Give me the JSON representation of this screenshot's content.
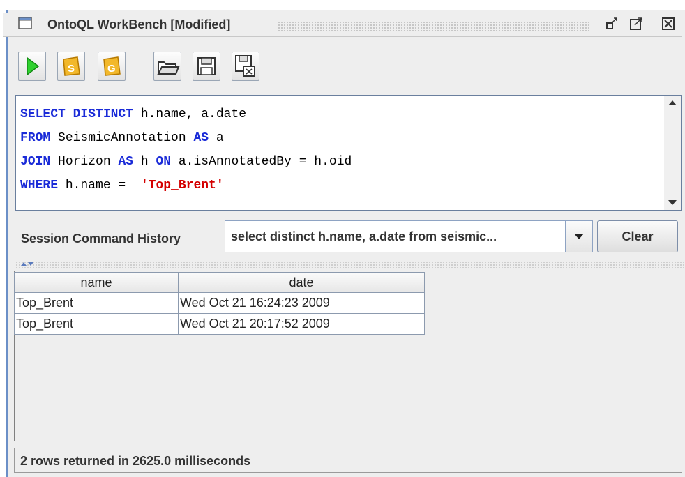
{
  "window": {
    "title": "OntoQL WorkBench [Modified]",
    "buttons": [
      "minimize-icon",
      "maximize-icon",
      "close-icon"
    ]
  },
  "toolbar": {
    "buttons": [
      {
        "name": "run-query-button",
        "icon": "play-icon"
      },
      {
        "name": "s-button",
        "label": "S"
      },
      {
        "name": "g-button",
        "label": "G"
      },
      {
        "name": "open-button",
        "icon": "folder-icon"
      },
      {
        "name": "save-button",
        "icon": "floppy-icon"
      },
      {
        "name": "export-button",
        "icon": "floppy-export-icon"
      }
    ]
  },
  "editor": {
    "lines": [
      [
        {
          "t": "SELECT DISTINCT",
          "kw": true
        },
        {
          "t": " h.name, a.date"
        }
      ],
      [
        {
          "t": "FROM",
          "kw": true
        },
        {
          "t": " SeismicAnnotation "
        },
        {
          "t": "AS",
          "kw": true
        },
        {
          "t": " a"
        }
      ],
      [
        {
          "t": "JOIN",
          "kw": true
        },
        {
          "t": " Horizon "
        },
        {
          "t": "AS",
          "kw": true
        },
        {
          "t": " h "
        },
        {
          "t": "ON",
          "kw": true
        },
        {
          "t": " a.isAnnotatedBy = h.oid"
        }
      ],
      [
        {
          "t": "WHERE",
          "kw": true
        },
        {
          "t": " h.name =  "
        },
        {
          "t": "'Top_Brent'",
          "str": true
        }
      ]
    ]
  },
  "history": {
    "label": "Session Command History",
    "selected": "select distinct h.name, a.date from seismic...",
    "clear_label": "Clear"
  },
  "results": {
    "columns": [
      "name",
      "date"
    ],
    "rows": [
      [
        "Top_Brent",
        "Wed Oct 21 16:24:23 2009"
      ],
      [
        "Top_Brent",
        "Wed Oct 21 20:17:52 2009"
      ]
    ]
  },
  "status": {
    "text": "2 rows returned in 2625.0 milliseconds"
  },
  "colors": {
    "keyword": "#1a2bd8",
    "string": "#d40000",
    "frame_accent": "#6b8fc7"
  }
}
